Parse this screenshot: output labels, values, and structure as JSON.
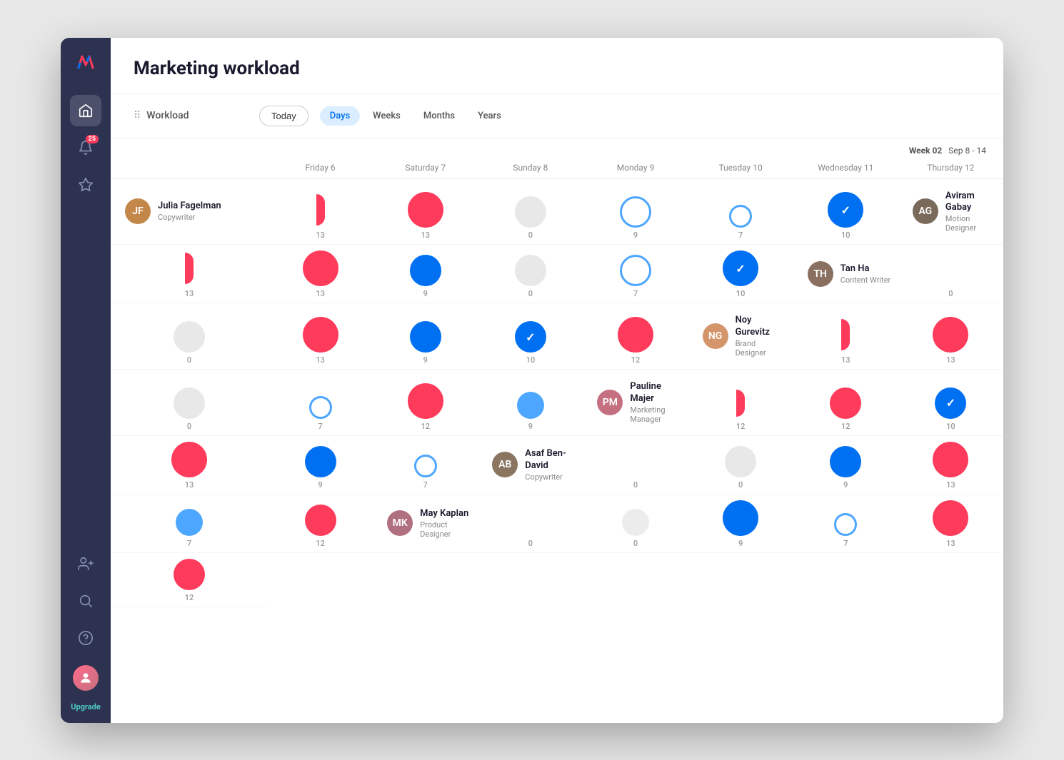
{
  "app": {
    "title": "Marketing workload"
  },
  "sidebar": {
    "logo_text": "//",
    "badge_count": "25",
    "upgrade_label": "Upgrade",
    "icons": [
      {
        "name": "home-icon",
        "label": "Home"
      },
      {
        "name": "bell-icon",
        "label": "Notifications"
      },
      {
        "name": "star-icon",
        "label": "Favorites"
      },
      {
        "name": "add-user-icon",
        "label": "Add User"
      },
      {
        "name": "search-icon",
        "label": "Search"
      },
      {
        "name": "help-icon",
        "label": "Help"
      }
    ]
  },
  "toolbar": {
    "workload_label": "Workload",
    "today_label": "Today",
    "views": [
      {
        "id": "days",
        "label": "Days",
        "active": true
      },
      {
        "id": "weeks",
        "label": "Weeks",
        "active": false
      },
      {
        "id": "months",
        "label": "Months",
        "active": false
      },
      {
        "id": "years",
        "label": "Years",
        "active": false
      }
    ]
  },
  "week": {
    "label": "Week 02",
    "range": "Sep 8 - 14"
  },
  "columns": [
    {
      "id": "person",
      "label": ""
    },
    {
      "id": "fri",
      "label": "Friday 6"
    },
    {
      "id": "sat",
      "label": "Saturday 7"
    },
    {
      "id": "sun",
      "label": "Sunday 8"
    },
    {
      "id": "mon",
      "label": "Monday 9"
    },
    {
      "id": "tue",
      "label": "Tuesday 10"
    },
    {
      "id": "wed",
      "label": "Wednesday 11"
    },
    {
      "id": "thu",
      "label": "Thursday 12"
    }
  ],
  "people": [
    {
      "name": "Julia Fagelman",
      "role": "Copywriter",
      "avatar_initials": "JF",
      "avatar_class": "av-julia",
      "days": [
        {
          "type": "pink-half",
          "value": "13"
        },
        {
          "type": "pink-lg",
          "value": "13"
        },
        {
          "type": "gray",
          "value": "0"
        },
        {
          "type": "blue-ring",
          "value": "9"
        },
        {
          "type": "blue-ring-sm",
          "value": "7"
        },
        {
          "type": "blue-lg-check",
          "value": "10"
        }
      ]
    },
    {
      "name": "Aviram Gabay",
      "role": "Motion Designer",
      "avatar_initials": "AG",
      "avatar_class": "av-aviram",
      "days": [
        {
          "type": "pink-half",
          "value": "13"
        },
        {
          "type": "pink-lg",
          "value": "13"
        },
        {
          "type": "blue-md",
          "value": "9"
        },
        {
          "type": "gray",
          "value": "0"
        },
        {
          "type": "blue-ring",
          "value": "7"
        },
        {
          "type": "blue-lg-check",
          "value": "10"
        }
      ]
    },
    {
      "name": "Tan Ha",
      "role": "Content Writer",
      "avatar_initials": "TH",
      "avatar_class": "av-tanha",
      "days": [
        {
          "type": "empty",
          "value": "0"
        },
        {
          "type": "gray",
          "value": "0"
        },
        {
          "type": "pink-lg",
          "value": "13"
        },
        {
          "type": "blue-md",
          "value": "9"
        },
        {
          "type": "blue-md-check",
          "value": "10"
        },
        {
          "type": "pink-lg",
          "value": "12"
        }
      ]
    },
    {
      "name": "Noy Gurevitz",
      "role": "Brand Designer",
      "avatar_initials": "NG",
      "avatar_class": "av-noy",
      "days": [
        {
          "type": "pink-half",
          "value": "13"
        },
        {
          "type": "pink-lg",
          "value": "13"
        },
        {
          "type": "gray",
          "value": "0"
        },
        {
          "type": "blue-sm",
          "value": "7"
        },
        {
          "type": "pink-lg",
          "value": "12"
        },
        {
          "type": "blue-sm",
          "value": "9"
        }
      ]
    },
    {
      "name": "Pauline Majer",
      "role": "Marketing Manager",
      "avatar_initials": "PM",
      "avatar_class": "av-pauline",
      "days": [
        {
          "type": "pink-half-sm",
          "value": "12"
        },
        {
          "type": "pink-md",
          "value": "12"
        },
        {
          "type": "blue-md-check",
          "value": "10"
        },
        {
          "type": "pink-lg",
          "value": "13"
        },
        {
          "type": "blue-md",
          "value": "9"
        },
        {
          "type": "blue-sm",
          "value": "7"
        }
      ]
    },
    {
      "name": "Asaf Ben-David",
      "role": "Copywriter",
      "avatar_initials": "AB",
      "avatar_class": "av-asaf",
      "days": [
        {
          "type": "empty",
          "value": "0"
        },
        {
          "type": "gray",
          "value": "0"
        },
        {
          "type": "blue-md",
          "value": "9"
        },
        {
          "type": "pink-lg",
          "value": "13"
        },
        {
          "type": "blue-sm",
          "value": "7"
        },
        {
          "type": "pink-md",
          "value": "12"
        }
      ]
    },
    {
      "name": "May Kaplan",
      "role": "Product Designer",
      "avatar_initials": "MK",
      "avatar_class": "av-may",
      "days": [
        {
          "type": "empty",
          "value": "0"
        },
        {
          "type": "gray-sm",
          "value": "0"
        },
        {
          "type": "blue-lg",
          "value": "9"
        },
        {
          "type": "blue-ring-sm",
          "value": "7"
        },
        {
          "type": "pink-lg",
          "value": "13"
        },
        {
          "type": "pink-md",
          "value": "12"
        }
      ]
    }
  ]
}
